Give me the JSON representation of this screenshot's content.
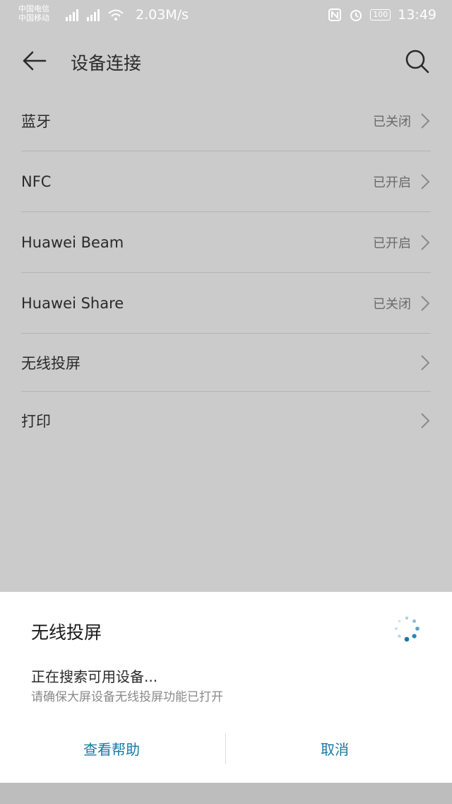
{
  "status_bar": {
    "carrier_1": "中国电信",
    "carrier_2": "中国移动",
    "net_speed": "2.03M/s",
    "battery": "100",
    "time": "13:49"
  },
  "app_bar": {
    "title": "设备连接"
  },
  "list": [
    {
      "label": "蓝牙",
      "status": "已关闭"
    },
    {
      "label": "NFC",
      "status": "已开启"
    },
    {
      "label": "Huawei Beam",
      "status": "已开启"
    },
    {
      "label": "Huawei Share",
      "status": "已关闭"
    },
    {
      "label": "无线投屏",
      "status": ""
    },
    {
      "label": "打印",
      "status": ""
    }
  ],
  "dialog": {
    "title": "无线投屏",
    "searching_text": "正在搜索可用设备...",
    "hint_text": "请确保大屏设备无线投屏功能已打开",
    "help_button": "查看帮助",
    "cancel_button": "取消"
  },
  "colors": {
    "accent": "#1479a8",
    "overlay_bg": "#cbcbcb",
    "sheet_bg": "#ffffff"
  },
  "icons": [
    "back-arrow-icon",
    "search-icon",
    "chevron-right-icon",
    "loading-spinner-icon",
    "nfc-icon",
    "alarm-icon",
    "wifi-icon",
    "signal-icon",
    "battery-icon"
  ]
}
